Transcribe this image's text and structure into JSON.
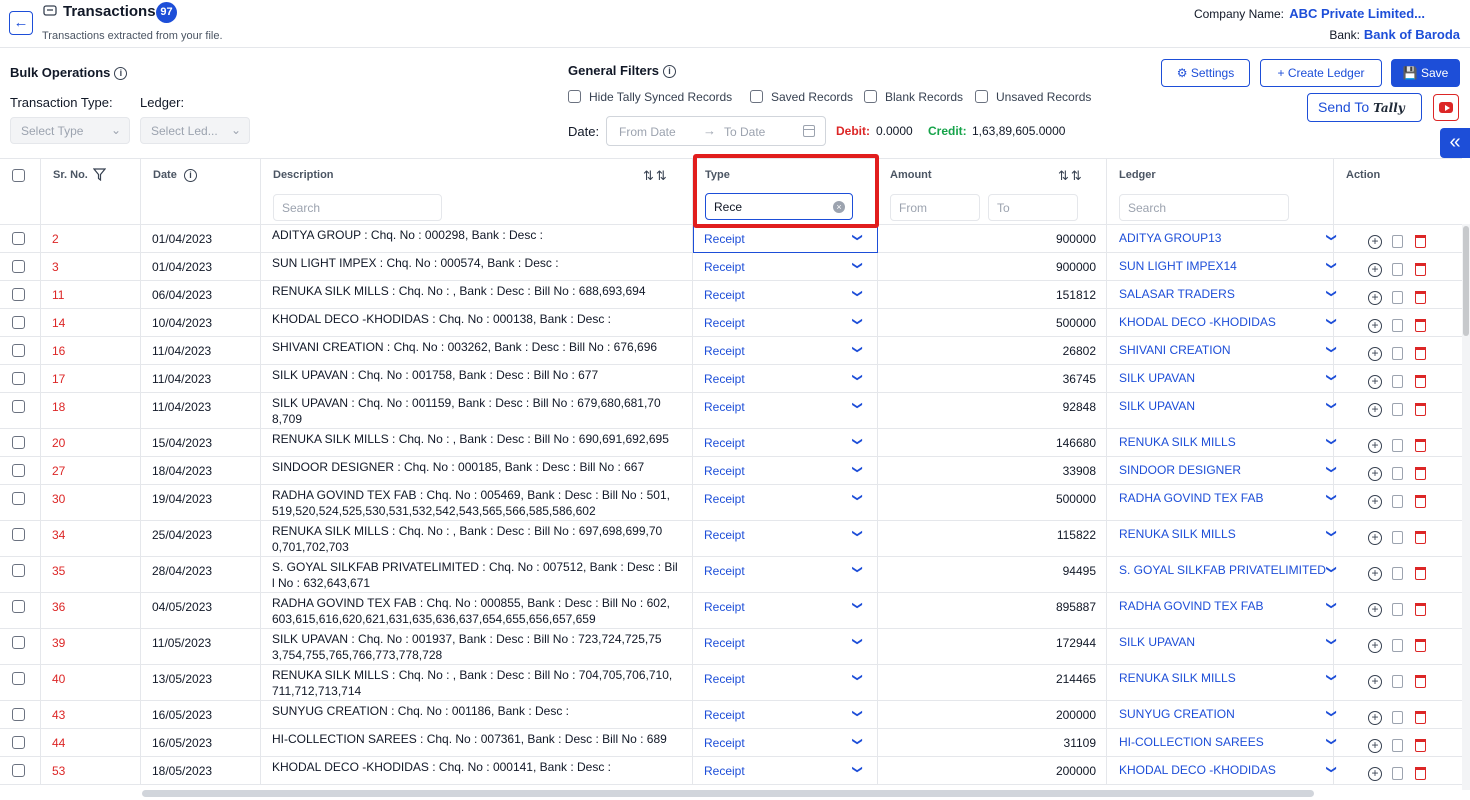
{
  "header": {
    "title": "Transactions",
    "count": "97",
    "subtitle": "Transactions extracted from your file.",
    "company_label": "Company Name:",
    "company_value": "ABC Private Limited...",
    "bank_label": "Bank:",
    "bank_value": "Bank of Baroda"
  },
  "bulk": {
    "title": "Bulk Operations",
    "transaction_type_label": "Transaction Type:",
    "ledger_label": "Ledger:",
    "type_placeholder": "Select Type",
    "ledger_placeholder": "Select Led..."
  },
  "filters": {
    "title": "General Filters",
    "options": [
      "Hide Tally Synced Records",
      "Saved Records",
      "Blank Records",
      "Unsaved Records"
    ],
    "date_label": "Date:",
    "from_placeholder": "From Date",
    "to_placeholder": "To Date",
    "debit_label": "Debit:",
    "debit_value": "0.0000",
    "credit_label": "Credit:",
    "credit_value": "1,63,89,605.0000"
  },
  "actions": {
    "settings": "Settings",
    "create_ledger": "Create Ledger",
    "save": "Save",
    "send_to": "Send To",
    "tally": "Tally"
  },
  "table": {
    "columns": {
      "sr_no": "Sr. No.",
      "date": "Date",
      "description": "Description",
      "type": "Type",
      "amount": "Amount",
      "ledger": "Ledger",
      "action": "Action"
    },
    "search_placeholder": "Search",
    "type_filter_value": "Rece",
    "amount_from_placeholder": "From",
    "amount_to_placeholder": "To",
    "rows": [
      {
        "sr": "2",
        "date": "01/04/2023",
        "desc": "ADITYA GROUP : Chq. No : 000298, Bank : Desc :",
        "type": "Receipt",
        "amount": "900000",
        "ledger": "ADITYA GROUP13"
      },
      {
        "sr": "3",
        "date": "01/04/2023",
        "desc": "SUN LIGHT IMPEX : Chq. No : 000574, Bank : Desc :",
        "type": "Receipt",
        "amount": "900000",
        "ledger": "SUN LIGHT IMPEX14"
      },
      {
        "sr": "11",
        "date": "06/04/2023",
        "desc": "RENUKA SILK MILLS : Chq. No : , Bank : Desc : Bill No : 688,693,694",
        "type": "Receipt",
        "amount": "151812",
        "ledger": "SALASAR TRADERS"
      },
      {
        "sr": "14",
        "date": "10/04/2023",
        "desc": "KHODAL DECO -KHODIDAS : Chq. No : 000138, Bank : Desc :",
        "type": "Receipt",
        "amount": "500000",
        "ledger": "KHODAL DECO -KHODIDAS"
      },
      {
        "sr": "16",
        "date": "11/04/2023",
        "desc": "SHIVANI CREATION : Chq. No : 003262, Bank : Desc : Bill No : 676,696",
        "type": "Receipt",
        "amount": "26802",
        "ledger": "SHIVANI CREATION"
      },
      {
        "sr": "17",
        "date": "11/04/2023",
        "desc": "SILK UPAVAN : Chq. No : 001758, Bank : Desc : Bill No : 677",
        "type": "Receipt",
        "amount": "36745",
        "ledger": "SILK UPAVAN"
      },
      {
        "sr": "18",
        "date": "11/04/2023",
        "desc": "SILK UPAVAN : Chq. No : 001159, Bank : Desc : Bill No : 679,680,681,70",
        "desc2": "8,709",
        "type": "Receipt",
        "amount": "92848",
        "ledger": "SILK UPAVAN"
      },
      {
        "sr": "20",
        "date": "15/04/2023",
        "desc": "RENUKA SILK MILLS : Chq. No : , Bank : Desc : Bill No : 690,691,692,695",
        "type": "Receipt",
        "amount": "146680",
        "ledger": "RENUKA SILK MILLS"
      },
      {
        "sr": "27",
        "date": "18/04/2023",
        "desc": "SINDOOR DESIGNER : Chq. No : 000185, Bank : Desc : Bill No : 667",
        "type": "Receipt",
        "amount": "33908",
        "ledger": "SINDOOR DESIGNER"
      },
      {
        "sr": "30",
        "date": "19/04/2023",
        "desc": "RADHA GOVIND TEX FAB : Chq. No : 005469, Bank : Desc : Bill No : 501,",
        "desc2": "519,520,524,525,530,531,532,542,543,565,566,585,586,602",
        "type": "Receipt",
        "amount": "500000",
        "ledger": "RADHA GOVIND TEX FAB"
      },
      {
        "sr": "34",
        "date": "25/04/2023",
        "desc": "RENUKA SILK MILLS : Chq. No : , Bank : Desc : Bill No : 697,698,699,70",
        "desc2": "0,701,702,703",
        "type": "Receipt",
        "amount": "115822",
        "ledger": "RENUKA SILK MILLS"
      },
      {
        "sr": "35",
        "date": "28/04/2023",
        "desc": "S. GOYAL SILKFAB PRIVATELIMITED : Chq. No : 007512, Bank : Desc : Bil",
        "desc2": "l No : 632,643,671",
        "type": "Receipt",
        "amount": "94495",
        "ledger": "S. GOYAL SILKFAB PRIVATELIMITED"
      },
      {
        "sr": "36",
        "date": "04/05/2023",
        "desc": "RADHA GOVIND TEX FAB : Chq. No : 000855, Bank : Desc : Bill No : 602,",
        "desc2": "603,615,616,620,621,631,635,636,637,654,655,656,657,659",
        "type": "Receipt",
        "amount": "895887",
        "ledger": "RADHA GOVIND TEX FAB"
      },
      {
        "sr": "39",
        "date": "11/05/2023",
        "desc": "SILK UPAVAN : Chq. No : 001937, Bank : Desc : Bill No : 723,724,725,75",
        "desc2": "3,754,755,765,766,773,778,728",
        "type": "Receipt",
        "amount": "172944",
        "ledger": "SILK UPAVAN"
      },
      {
        "sr": "40",
        "date": "13/05/2023",
        "desc": "RENUKA SILK MILLS : Chq. No : , Bank : Desc : Bill No : 704,705,706,710,",
        "desc2": "711,712,713,714",
        "type": "Receipt",
        "amount": "214465",
        "ledger": "RENUKA SILK MILLS"
      },
      {
        "sr": "43",
        "date": "16/05/2023",
        "desc": "SUNYUG CREATION : Chq. No : 001186, Bank : Desc :",
        "type": "Receipt",
        "amount": "200000",
        "ledger": "SUNYUG CREATION"
      },
      {
        "sr": "44",
        "date": "16/05/2023",
        "desc": "HI-COLLECTION SAREES : Chq. No : 007361, Bank : Desc : Bill No : 689",
        "type": "Receipt",
        "amount": "31109",
        "ledger": "HI-COLLECTION SAREES"
      },
      {
        "sr": "53",
        "date": "18/05/2023",
        "desc": "KHODAL DECO -KHODIDAS : Chq. No : 000141, Bank : Desc :",
        "type": "Receipt",
        "amount": "200000",
        "ledger": "KHODAL DECO -KHODIDAS"
      }
    ]
  }
}
